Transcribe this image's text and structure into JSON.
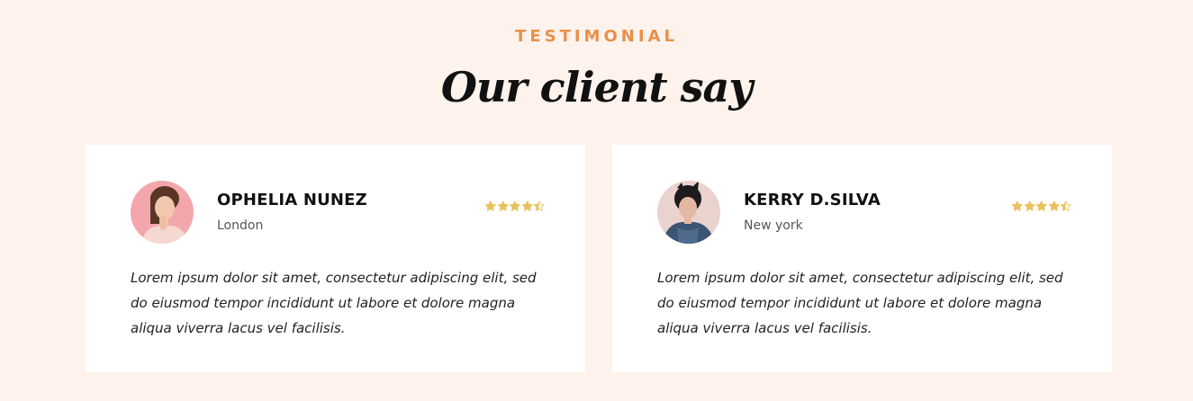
{
  "section": {
    "eyebrow": "TESTIMONIAL",
    "title": "Our client say"
  },
  "colors": {
    "background": "#fdf2ec",
    "accent": "#e8904a",
    "star": "#e9c15c",
    "card": "#ffffff"
  },
  "testimonials": [
    {
      "name": "OPHELIA NUNEZ",
      "location": "London",
      "rating": 4.5,
      "rating_max": 5,
      "avatar_icon": "woman-thinking-portrait",
      "quote": "Lorem ipsum dolor sit amet, consectetur adipiscing elit, sed do eiusmod tempor incididunt ut labore et dolore magna aliqua viverra lacus vel facilisis."
    },
    {
      "name": "KERRY D.SILVA",
      "location": "New york",
      "rating": 4.5,
      "rating_max": 5,
      "avatar_icon": "woman-portrait",
      "quote": "Lorem ipsum dolor sit amet, consectetur adipiscing elit, sed do eiusmod tempor incididunt ut labore et dolore magna aliqua viverra lacus vel facilisis."
    }
  ]
}
